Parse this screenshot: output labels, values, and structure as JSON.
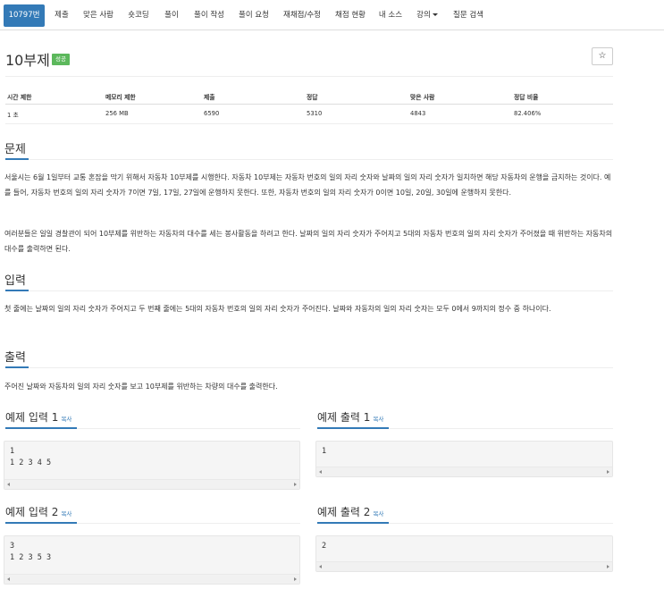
{
  "tabs": [
    {
      "label": "10797번",
      "active": true
    },
    {
      "label": "제출"
    },
    {
      "label": "맞은 사람"
    },
    {
      "label": "숏코딩"
    },
    {
      "label": "풀이"
    },
    {
      "label": "풀이 작성"
    },
    {
      "label": "풀이 요청"
    },
    {
      "label": "재채점/수정"
    },
    {
      "label": "채점 현황"
    },
    {
      "label": "내 소스"
    },
    {
      "label": "강의"
    },
    {
      "label": "질문 검색"
    }
  ],
  "problem": {
    "title": "10부제",
    "status_badge": "성공",
    "star_icon": "☆"
  },
  "info": {
    "headers": [
      "시간 제한",
      "메모리 제한",
      "제출",
      "정답",
      "맞은 사람",
      "정답 비율"
    ],
    "values": [
      "1 초",
      "256 MB",
      "6590",
      "5310",
      "4843",
      "82.406%"
    ]
  },
  "sections": {
    "problem_title": "문제",
    "problem_p1": "서울시는 6월 1일부터 교통 혼잡을 막기 위해서 자동차 10부제를 시행한다. 자동차 10부제는 자동차 번호의 일의 자리 숫자와 날짜의 일의 자리 숫자가 일치하면 해당 자동차의 운행을 금지하는 것이다. 예를 들어, 자동차 번호의 일의 자리 숫자가 7이면 7일, 17일, 27일에 운행하지 못한다. 또한, 자동차 번호의 일의 자리 숫자가 0이면 10일, 20일, 30일에 운행하지 못한다.",
    "problem_p2": "여러분들은 일일 경찰관이 되어 10부제를 위반하는 자동차의 대수를 세는 봉사활동을 하려고 한다. 날짜의 일의 자리 숫자가 주어지고 5대의 자동차 번호의 일의 자리 숫자가 주어졌을 때 위반하는 자동차의 대수를 출력하면 된다.",
    "input_title": "입력",
    "input_p": "첫 줄에는 날짜의 일의 자리 숫자가 주어지고 두 번째 줄에는 5대의 자동차 번호의 일의 자리 숫자가 주어진다. 날짜와 자동차의 일의 자리 숫자는 모두 0에서 9까지의 정수 중 하나이다.",
    "output_title": "출력",
    "output_p": "주어진 날짜와 자동차의 일의 자리 숫자를 보고 10부제를 위반하는 차량의 대수를 출력한다."
  },
  "samples": {
    "copy_label": "복사",
    "input1_title": "예제 입력 1",
    "input1_text": "1\n1 2 3 4 5",
    "output1_title": "예제 출력 1",
    "output1_text": "1",
    "input2_title": "예제 입력 2",
    "input2_text": "3\n1 2 3 5 3",
    "output2_title": "예제 출력 2",
    "output2_text": "2"
  },
  "colors": {
    "accent": "#337ab7",
    "success": "#5cb85c"
  }
}
